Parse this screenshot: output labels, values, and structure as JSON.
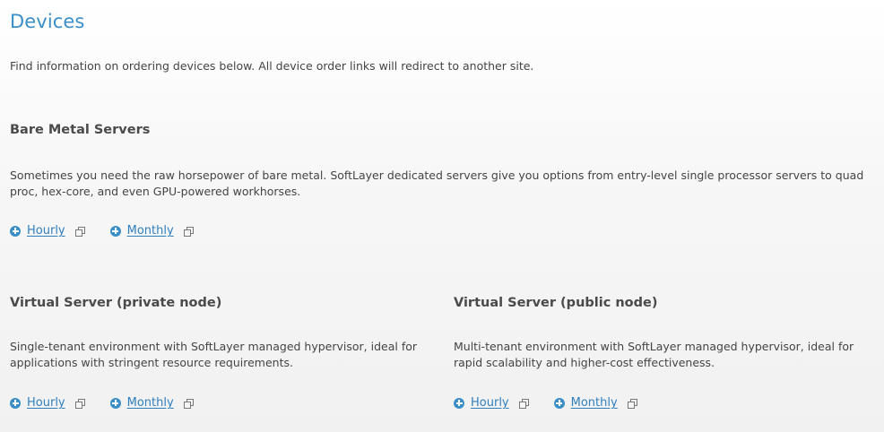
{
  "page": {
    "title": "Devices",
    "intro": "Find information on ordering devices below. All device order links will redirect to another site."
  },
  "sections": [
    {
      "title": "Bare Metal Servers",
      "description": "Sometimes you need the raw horsepower of bare metal. SoftLayer dedicated servers give you options from entry-level single processor servers to quad proc, hex-core, and even GPU-powered workhorses.",
      "links": [
        {
          "label": "Hourly"
        },
        {
          "label": "Monthly"
        }
      ]
    },
    {
      "title": "Virtual Server (private node)",
      "description": "Single-tenant environment with SoftLayer managed hypervisor, ideal for applications with stringent resource requirements.",
      "links": [
        {
          "label": "Hourly"
        },
        {
          "label": "Monthly"
        }
      ]
    },
    {
      "title": "Virtual Server (public node)",
      "description": "Multi-tenant environment with SoftLayer managed hypervisor, ideal for rapid scalability and higher-cost effectiveness.",
      "links": [
        {
          "label": "Hourly"
        },
        {
          "label": "Monthly"
        }
      ]
    }
  ],
  "icons": {
    "add": "plus-circle-icon",
    "external": "external-link-icon"
  },
  "colors": {
    "title": "#3b8fc7",
    "link": "#2f7fbf",
    "icon": "#3b8fc7",
    "text": "#444444"
  }
}
